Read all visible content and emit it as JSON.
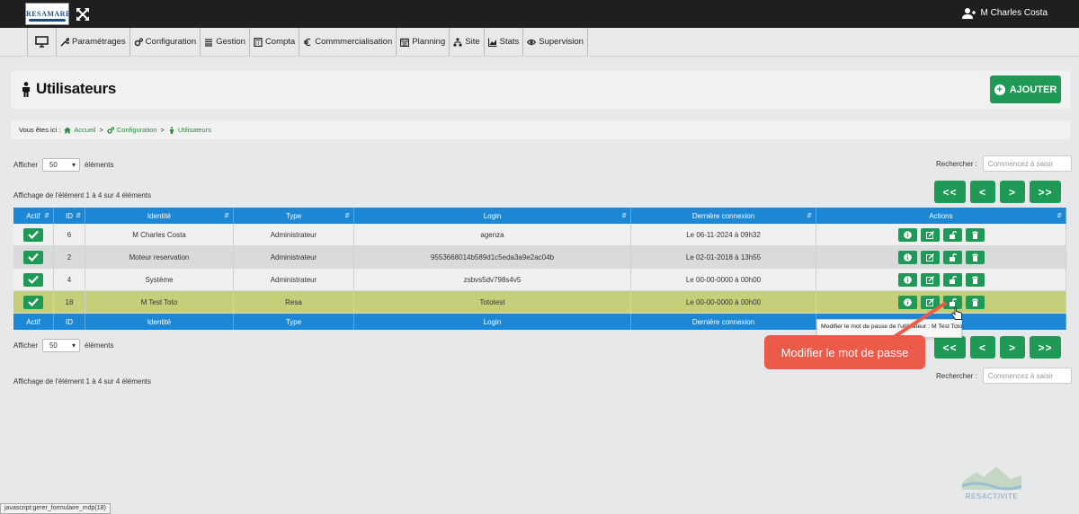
{
  "header": {
    "logo_text": "RESAMARE",
    "user_name": "M Charles Costa"
  },
  "nav": {
    "items": [
      {
        "label": "Paramétrages",
        "icon": "wrench-icon"
      },
      {
        "label": "Configuration",
        "icon": "cogs-icon"
      },
      {
        "label": "Gestion",
        "icon": "list-icon"
      },
      {
        "label": "Compta",
        "icon": "calculator-icon"
      },
      {
        "label": "Commmercialisation",
        "icon": "euro-icon"
      },
      {
        "label": "Planning",
        "icon": "calendar-icon"
      },
      {
        "label": "Site",
        "icon": "sitemap-icon"
      },
      {
        "label": "Stats",
        "icon": "chart-icon"
      },
      {
        "label": "Supervision",
        "icon": "eye-icon"
      }
    ]
  },
  "page": {
    "title": "Utilisateurs",
    "add_button": "AJOUTER"
  },
  "breadcrumb": {
    "prefix": "Vous êtes ici :",
    "items": [
      "Accueil",
      "Configuration",
      "Utilisateurs"
    ],
    "separator": ">"
  },
  "list_controls": {
    "show_label": "Afficher",
    "page_size": "50",
    "elements_label": "éléments",
    "info_text": "Affichage de l'élément 1 à 4 sur 4 éléments",
    "search_label": "Rechercher :",
    "search_placeholder": "Commencez à saisir"
  },
  "pager": {
    "first": "<<",
    "prev": "<",
    "next": ">",
    "last": ">>"
  },
  "table": {
    "columns": [
      "Actif",
      "ID",
      "Identité",
      "Type",
      "Login",
      "Dernière connexion",
      "Actions"
    ],
    "rows": [
      {
        "id": "6",
        "identite": "M Charles Costa",
        "type": "Administrateur",
        "login": "agenza",
        "last": "Le 06-11-2024 à 09h32"
      },
      {
        "id": "2",
        "identite": "Moteur reservation",
        "type": "Administrateur",
        "login": "9553668014b589d1c5eda3a9e2ac04b",
        "last": "Le 02-01-2018 à 13h55"
      },
      {
        "id": "4",
        "identite": "Système",
        "type": "Administrateur",
        "login": "zsbvs5dv798s4v5",
        "last": "Le 00-00-0000 à 00h00"
      },
      {
        "id": "18",
        "identite": "M Test Toto",
        "type": "Resa",
        "login": "Tototest",
        "last": "Le 00-00-0000 à 00h00"
      }
    ]
  },
  "tooltip": {
    "text": "Modifier le mot de passe de l'utilisateur : M Test Toto"
  },
  "callout": {
    "text": "Modifier le mot de passe"
  },
  "footer_logo_text": "RESACTIVITE",
  "status_bar": "javascript:gerer_formulaire_mdp(18)",
  "colors": {
    "green": "#1f9a56",
    "table_header_blue": "#1c87d5",
    "highlight_row": "#c5cf7a",
    "callout_red": "#ec5a4a"
  }
}
